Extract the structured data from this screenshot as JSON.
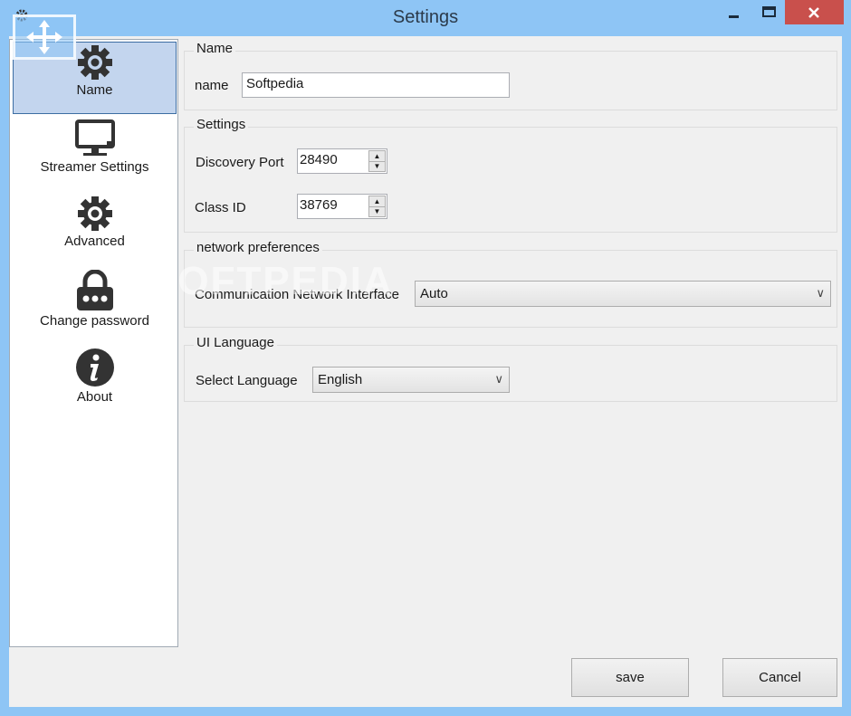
{
  "window": {
    "title": "Settings",
    "controls": {
      "minimize": "–",
      "maximize": "□",
      "close": "×"
    },
    "colors": {
      "frame": "#8ec5f5",
      "close": "#c9504c",
      "selected": "#c3d5ee"
    }
  },
  "sidebar": {
    "items": [
      {
        "label": "Name",
        "icon": "gear-icon",
        "selected": true
      },
      {
        "label": "Streamer Settings",
        "icon": "monitor-icon",
        "selected": false
      },
      {
        "label": "Advanced",
        "icon": "gear-icon",
        "selected": false
      },
      {
        "label": "Change password",
        "icon": "lock-icon",
        "selected": false
      },
      {
        "label": "About",
        "icon": "info-icon",
        "selected": false
      }
    ]
  },
  "main": {
    "name_group": {
      "title": "Name",
      "name_label": "name",
      "name_value": "Softpedia"
    },
    "settings_group": {
      "title": "Settings",
      "port_label": "Discovery Port",
      "port_value": "28490",
      "class_label": "Class ID",
      "class_value": "38769"
    },
    "network_group": {
      "title": "network preferences",
      "interface_label": "Communication Network Interface",
      "interface_value": "Auto"
    },
    "language_group": {
      "title": "UI Language",
      "language_label": "Select Language",
      "language_value": "English"
    }
  },
  "footer": {
    "save_label": "save",
    "cancel_label": "Cancel"
  },
  "watermark": "SOFTPEDIA"
}
